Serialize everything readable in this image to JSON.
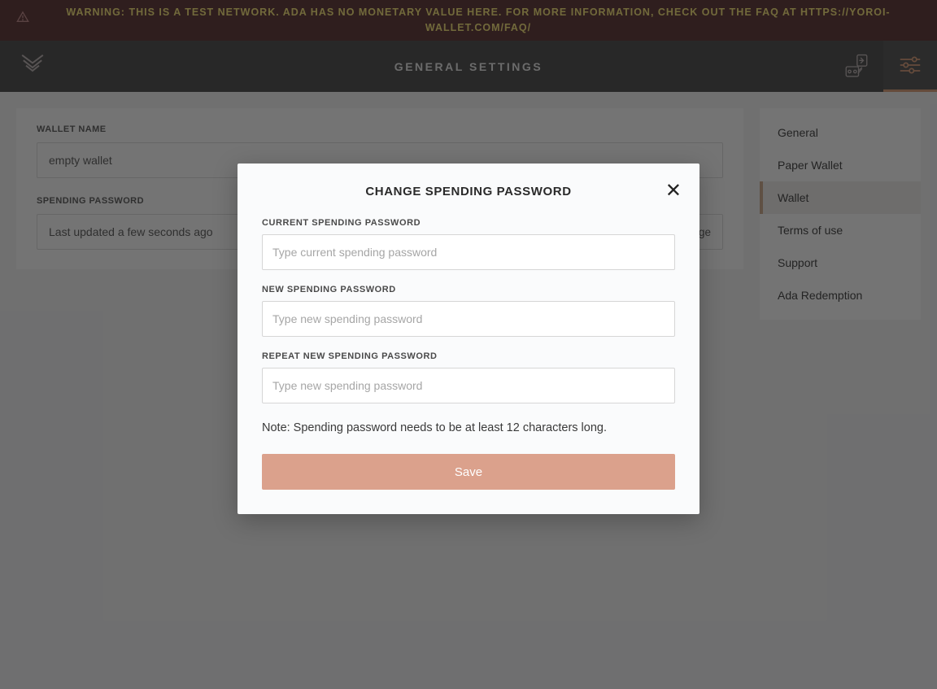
{
  "banner": {
    "text": "WARNING: THIS IS A TEST NETWORK. ADA HAS NO MONETARY VALUE HERE. FOR MORE INFORMATION, CHECK OUT THE FAQ AT HTTPS://YOROI-WALLET.COM/FAQ/"
  },
  "header": {
    "title": "GENERAL SETTINGS"
  },
  "main": {
    "wallet_name_label": "WALLET NAME",
    "wallet_name_value": "empty wallet",
    "spending_password_label": "SPENDING PASSWORD",
    "spending_password_value": "Last updated a few seconds ago",
    "change_link": "change"
  },
  "sidebar": {
    "items": [
      {
        "label": "General"
      },
      {
        "label": "Paper Wallet"
      },
      {
        "label": "Wallet"
      },
      {
        "label": "Terms of use"
      },
      {
        "label": "Support"
      },
      {
        "label": "Ada Redemption"
      }
    ]
  },
  "modal": {
    "title": "CHANGE SPENDING PASSWORD",
    "current_label": "CURRENT SPENDING PASSWORD",
    "current_placeholder": "Type current spending password",
    "new_label": "NEW SPENDING PASSWORD",
    "new_placeholder": "Type new spending password",
    "repeat_label": "REPEAT NEW SPENDING PASSWORD",
    "repeat_placeholder": "Type new spending password",
    "note": "Note: Spending password needs to be at least 12 characters long.",
    "save": "Save"
  }
}
